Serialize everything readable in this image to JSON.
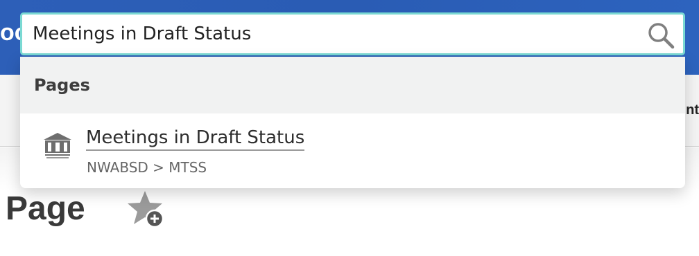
{
  "header": {
    "brand_fragment": "oo",
    "accent": "#2d5fb8"
  },
  "subnav": {
    "fragment": "nt"
  },
  "page": {
    "title": "Page",
    "favorite_icon": "star-add-icon"
  },
  "search": {
    "value": "Meetings in Draft Status",
    "icon": "search-icon",
    "focus_color": "#7ad9d3"
  },
  "results": {
    "section_label": "Pages",
    "items": [
      {
        "title": "Meetings in Draft Status",
        "path": "NWABSD > MTSS",
        "icon": "building-icon"
      }
    ]
  }
}
